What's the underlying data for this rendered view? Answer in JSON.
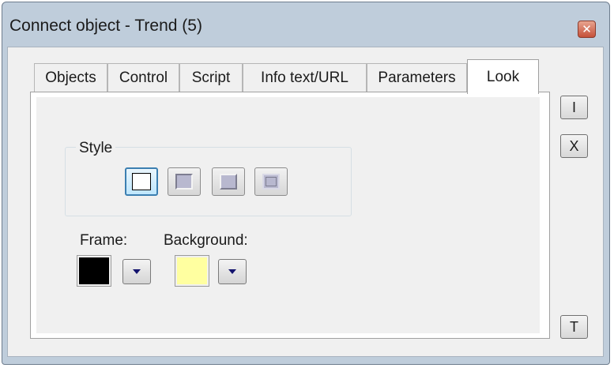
{
  "window": {
    "title": "Connect object - Trend (5)"
  },
  "titlebar": {
    "close_glyph": "✕"
  },
  "tabs": [
    {
      "label": "Objects"
    },
    {
      "label": "Control"
    },
    {
      "label": "Script"
    },
    {
      "label": "Info text/URL"
    },
    {
      "label": "Parameters"
    },
    {
      "label": "Look",
      "active": true
    }
  ],
  "look": {
    "style_group_label": "Style",
    "style_options": [
      "flat",
      "sunken",
      "raised",
      "double"
    ],
    "selected_style": "flat",
    "frame_label": "Frame:",
    "frame_color": "#000000",
    "background_label": "Background:",
    "background_color": "#ffffa0"
  },
  "side_buttons": {
    "insert_glyph": "I",
    "delete_glyph": "X",
    "text_glyph": "T"
  },
  "icons": {
    "dropdown": "triangle-down-icon",
    "close": "close-icon"
  }
}
